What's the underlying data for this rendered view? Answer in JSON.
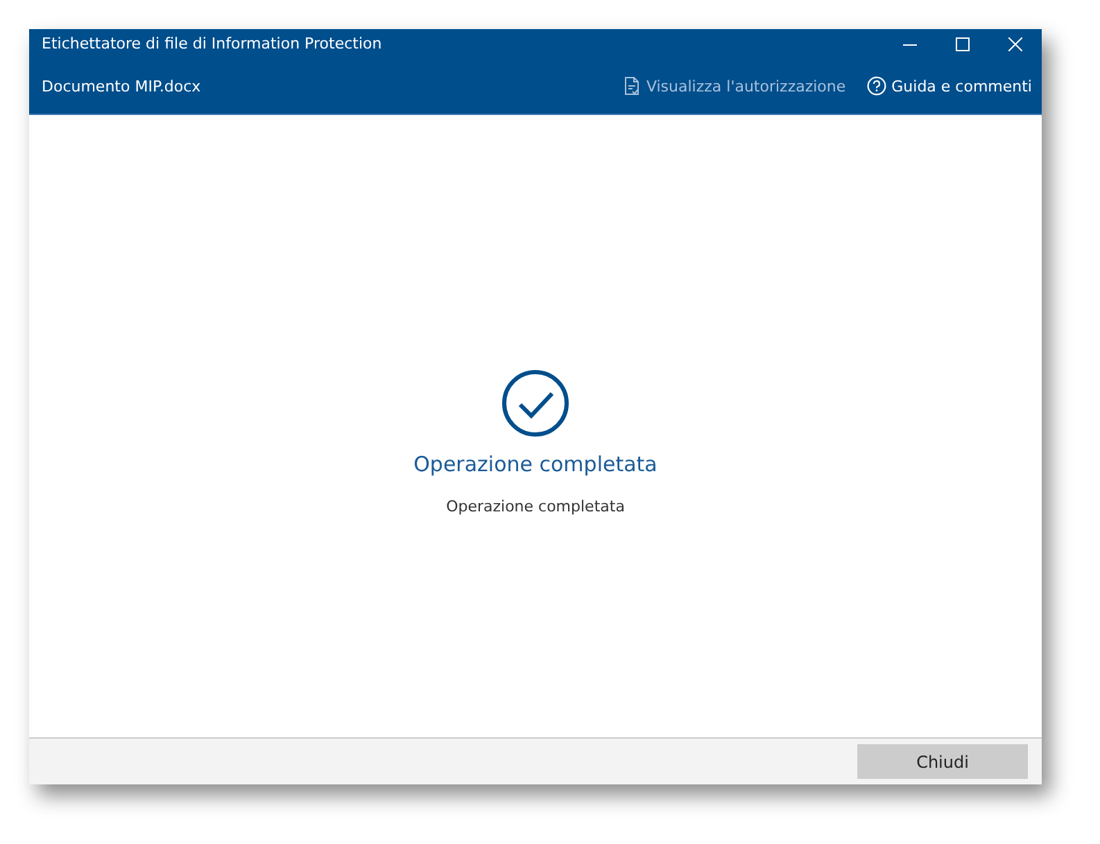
{
  "window": {
    "title": "Etichettatore di file di Information Protection"
  },
  "header": {
    "file_name": "Documento MIP.docx",
    "actions": [
      {
        "kind": "permission",
        "label": "Visualizza l'autorizzazione",
        "disabled": true
      },
      {
        "kind": "help",
        "label": "Guida e commenti",
        "disabled": false
      }
    ]
  },
  "result": {
    "heading": "Operazione completata",
    "message": "Operazione completata"
  },
  "footer": {
    "buttons": [
      "Chiudi"
    ]
  }
}
